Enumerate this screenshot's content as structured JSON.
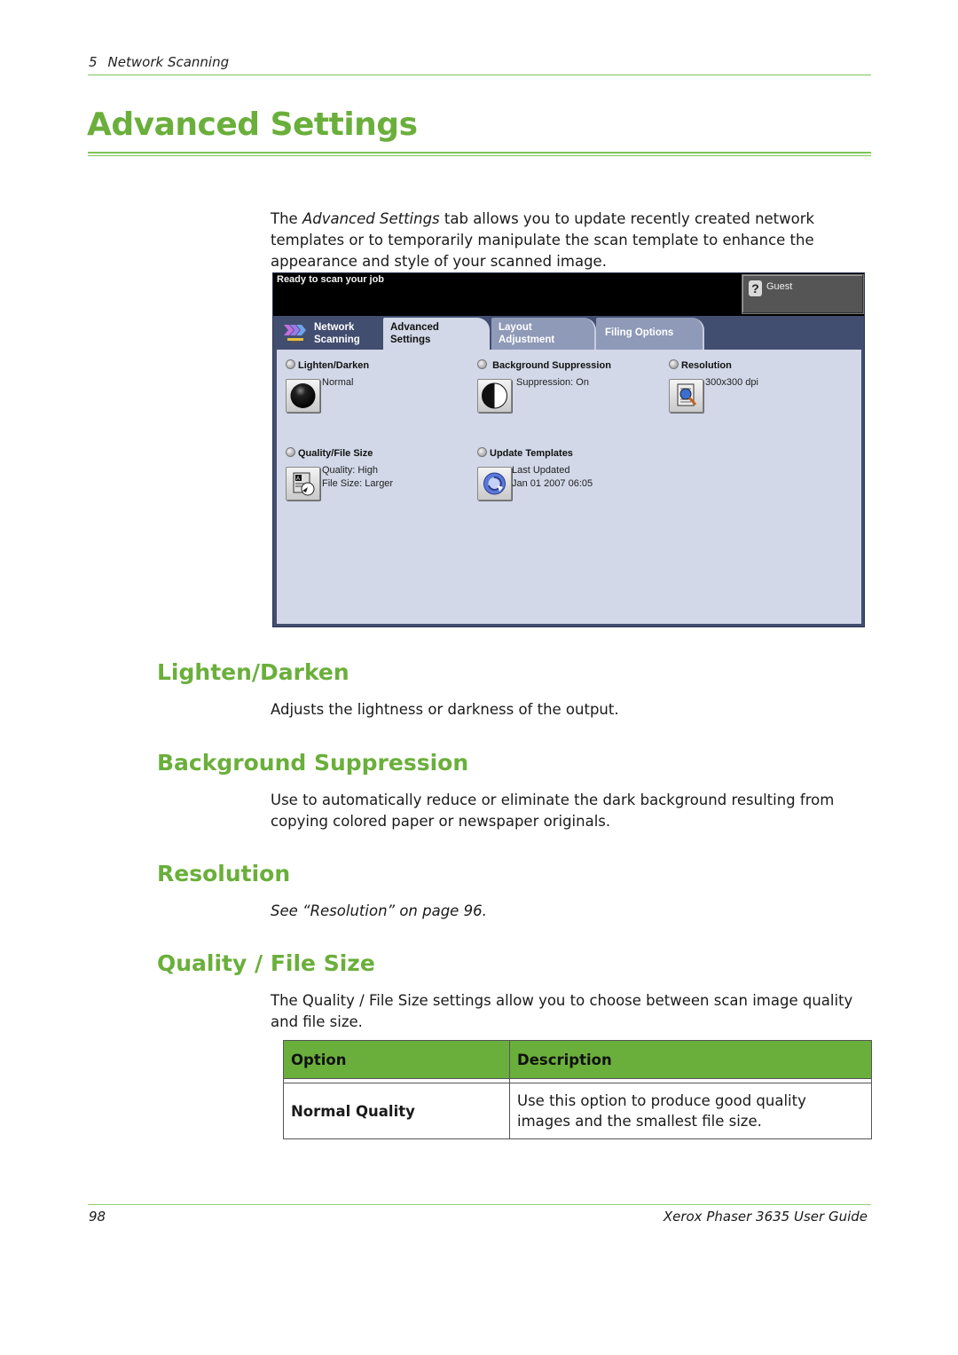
{
  "header": {
    "chapter_number": "5",
    "chapter_title": "Network Scanning"
  },
  "page_title": "Advanced Settings",
  "intro": {
    "before": "The ",
    "emphasis": "Advanced Settings",
    "after": " tab allows you to update recently created network templates or to temporarily manipulate the scan template to enhance the appearance and style of your scanned image."
  },
  "device_screen": {
    "status_message": "Ready to scan your job",
    "user_button": {
      "icon": "help-icon",
      "label": "Guest"
    },
    "tabs": [
      {
        "line1": "Network",
        "line2": "Scanning",
        "icon": "network-scanning-icon",
        "active": false
      },
      {
        "line1": "Advanced",
        "line2": "Settings",
        "active": true
      },
      {
        "line1": "Layout",
        "line2": "Adjustment",
        "active": false
      },
      {
        "line1": "Filing Options",
        "line2": "",
        "active": false
      }
    ],
    "features": [
      {
        "name": "Lighten/Darken",
        "icon": "lighten-darken-icon",
        "value_line1": "Normal",
        "value_line2": ""
      },
      {
        "name": "Background Suppression",
        "icon": "background-suppression-icon",
        "value_line1": "Suppression: On",
        "value_line2": ""
      },
      {
        "name": "Resolution",
        "icon": "resolution-icon",
        "value_line1": "300x300 dpi",
        "value_line2": ""
      },
      {
        "name": "Quality/File Size",
        "icon": "quality-file-size-icon",
        "value_line1": "Quality: High",
        "value_line2": "File Size: Larger"
      },
      {
        "name": "Update Templates",
        "icon": "update-templates-icon",
        "value_line1": "Last Updated",
        "value_line2": "Jan 01 2007 06:05"
      }
    ]
  },
  "sections": [
    {
      "heading": "Lighten/Darken",
      "body": "Adjusts the lightness or darkness of the output."
    },
    {
      "heading": "Background Suppression",
      "body": "Use to automatically reduce or eliminate the dark background resulting from copying colored paper or newspaper originals."
    },
    {
      "heading": "Resolution",
      "body": "See “Resolution” on page 96."
    },
    {
      "heading": "Quality / File Size",
      "body": "The Quality / File Size settings allow you to choose between scan image quality and file size."
    }
  ],
  "table": {
    "headers": [
      "Option",
      "Description"
    ],
    "rows": [
      {
        "option": "Normal Quality",
        "description": "Use this option to produce good quality images and the smallest file size."
      }
    ]
  },
  "footer": {
    "page_number": "98",
    "guide_title": "Xerox Phaser 3635 User Guide"
  },
  "colors": {
    "accent_green": "#6aaf3b",
    "rule_green": "#7dc35a",
    "screen_panel": "#d2d8e8",
    "screen_frame": "#424e70"
  }
}
